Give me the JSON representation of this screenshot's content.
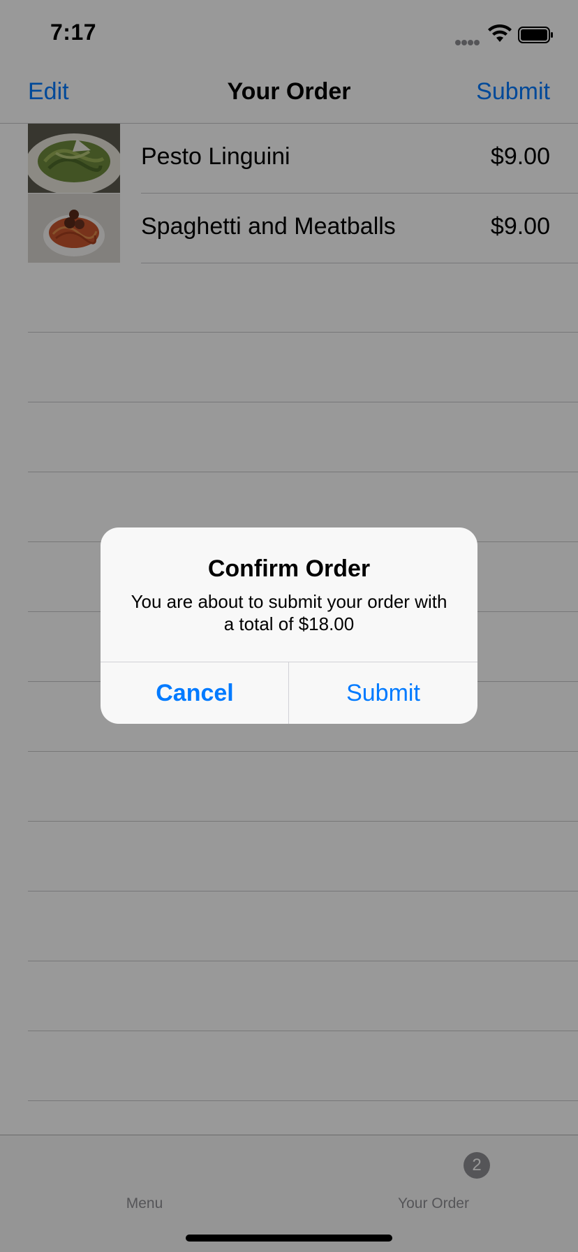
{
  "status_bar": {
    "time": "7:17"
  },
  "nav": {
    "left_label": "Edit",
    "title": "Your Order",
    "right_label": "Submit"
  },
  "order": {
    "items": [
      {
        "name": "Pesto Linguini",
        "price": "$9.00",
        "image": "pesto-linguini-photo"
      },
      {
        "name": "Spaghetti and Meatballs",
        "price": "$9.00",
        "image": "spaghetti-meatballs-photo"
      }
    ]
  },
  "tab_bar": {
    "tabs": [
      {
        "label": "Menu"
      },
      {
        "label": "Your Order",
        "badge": "2"
      }
    ]
  },
  "alert": {
    "title": "Confirm Order",
    "message": "You are about to submit your order with a total of $18.00",
    "cancel_label": "Cancel",
    "submit_label": "Submit"
  },
  "colors": {
    "accent": "#007aff",
    "overlay": "rgba(0,0,0,0.40)",
    "separator": "#c6c6c8",
    "tab_inactive": "#8e8e93"
  },
  "icons": [
    "cellular-signal-icon",
    "wifi-icon",
    "battery-icon",
    "badge-icon"
  ]
}
